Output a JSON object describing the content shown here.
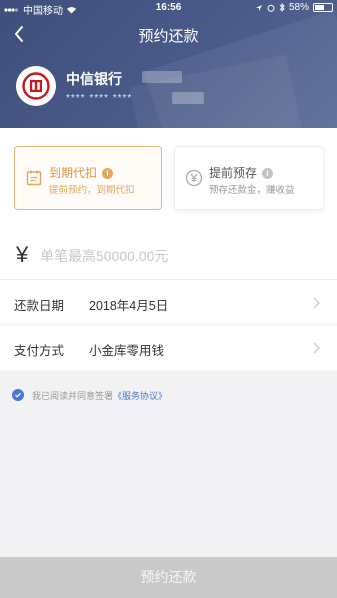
{
  "status_bar": {
    "carrier": "中国移动",
    "time": "16:56",
    "battery": "58%",
    "battery_level": 0.58
  },
  "nav": {
    "title": "预约还款",
    "back_icon": "chevron-left-icon"
  },
  "bank": {
    "name": "中信银行",
    "card_mask": "**** **** ****"
  },
  "options": [
    {
      "title": "到期代扣",
      "subtitle": "提前预约，到期代扣",
      "icon": "calendar-icon",
      "active": true
    },
    {
      "title": "提前预存",
      "subtitle": "预存还款金，赚收益",
      "icon": "yen-coin-icon",
      "active": false
    }
  ],
  "amount": {
    "symbol": "¥",
    "placeholder": "单笔最高50000.00元"
  },
  "fields": [
    {
      "label": "还款日期",
      "value": "2018年4月5日"
    },
    {
      "label": "支付方式",
      "value": "小金库零用钱"
    }
  ],
  "agreement": {
    "text": "我已阅读并同意签署",
    "link": "《服务协议》"
  },
  "submit_label": "预约还款",
  "colors": {
    "header": "#4a5a89",
    "accent_gold": "#e6b77a",
    "link_blue": "#4a77d8",
    "button_disabled": "#c9c9c9"
  }
}
